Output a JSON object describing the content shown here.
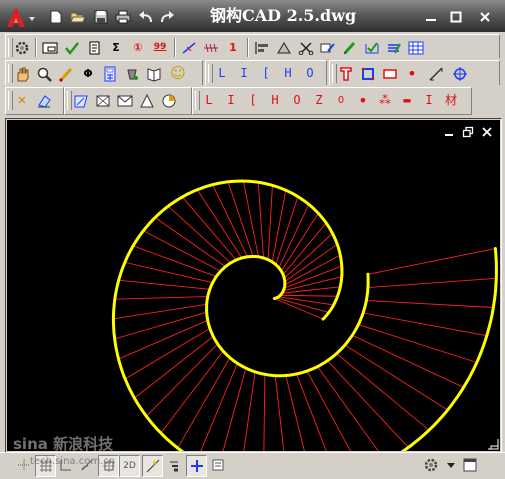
{
  "window": {
    "title": "钢构CAD 2.5.dwg",
    "controls": [
      "minimize",
      "restore",
      "close"
    ]
  },
  "quick_access": [
    "new-icon",
    "open-icon",
    "save-icon",
    "print-icon",
    "undo-icon",
    "redo-icon"
  ],
  "toolbar_row1": {
    "items": [
      {
        "name": "settings-icon"
      },
      {
        "name": "rectangle-frame-icon"
      },
      {
        "name": "check-icon"
      },
      {
        "name": "scroll-icon"
      },
      {
        "name": "sigma-icon",
        "text": "Σ"
      },
      {
        "name": "circled-one-icon",
        "text": "①"
      },
      {
        "name": "number-99-icon",
        "text": "99"
      },
      {
        "name": "slash-line-icon"
      },
      {
        "name": "dimension-icon"
      },
      {
        "name": "number-one-icon",
        "text": "1"
      },
      {
        "name": "align-icon"
      },
      {
        "name": "steel-shape-icon"
      },
      {
        "name": "scissors-icon"
      },
      {
        "name": "edit-text-icon"
      },
      {
        "name": "pencil-text-icon"
      },
      {
        "name": "check-frame-icon"
      },
      {
        "name": "layers-icon"
      },
      {
        "name": "grid-table-icon"
      }
    ]
  },
  "toolbar_row2": {
    "left": [
      {
        "name": "pan-hand-icon"
      },
      {
        "name": "zoom-icon"
      },
      {
        "name": "brush-icon"
      },
      {
        "name": "phi-icon",
        "text": "Φ"
      },
      {
        "name": "calculator-icon"
      },
      {
        "name": "paint-icon"
      },
      {
        "name": "book-icon"
      },
      {
        "name": "smiley-icon",
        "text": "☺"
      }
    ],
    "profiles_blue": [
      "L",
      "I",
      "[",
      "H",
      "O"
    ],
    "right": [
      {
        "name": "t-section-icon"
      },
      {
        "name": "square-tube-icon"
      },
      {
        "name": "plate-icon"
      },
      {
        "name": "round-bar-icon",
        "text": "•"
      },
      {
        "name": "slant-icon"
      },
      {
        "name": "bolt-icon"
      }
    ]
  },
  "toolbar_row3": {
    "left": [
      {
        "name": "erase-icon",
        "text": "✕"
      },
      {
        "name": "eraser-icon"
      },
      {
        "name": "hatch-icon"
      },
      {
        "name": "box-icon"
      },
      {
        "name": "envelope-icon"
      },
      {
        "name": "triangle-icon"
      },
      {
        "name": "circle-arc-icon"
      }
    ],
    "profiles_red": [
      "L",
      "I",
      "[",
      "H",
      "O",
      "Z",
      "O",
      "•",
      "⁂",
      "▬",
      "I",
      "材"
    ]
  },
  "drawing": {
    "background": "#000000",
    "spiral_color": "#ffff00",
    "ray_color": "#ff2020",
    "controls": [
      "minimize",
      "restore",
      "close"
    ]
  },
  "statusbar": {
    "watermark": "sina 新浪科技",
    "watermark_small": "tech.sina.com.cn",
    "buttons": [
      {
        "name": "snap-icon"
      },
      {
        "name": "grid-icon"
      },
      {
        "name": "ortho-icon"
      },
      {
        "name": "polar-icon"
      },
      {
        "name": "osnap-icon"
      },
      {
        "name": "otrack-icon",
        "text": "2D"
      },
      {
        "name": "dynamic-input-icon"
      },
      {
        "name": "lineweight-icon"
      },
      {
        "name": "crosshair-icon"
      },
      {
        "name": "quick-props-icon"
      },
      {
        "name": "workspace-gear-icon"
      },
      {
        "name": "dropdown-arrow-icon"
      },
      {
        "name": "fullscreen-icon"
      }
    ]
  }
}
